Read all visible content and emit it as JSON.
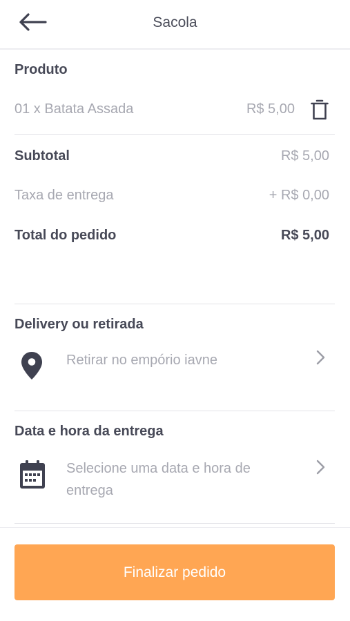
{
  "header": {
    "title": "Sacola",
    "back_icon": "arrow-left-icon"
  },
  "produto": {
    "heading": "Produto",
    "items": [
      {
        "text": "01 x Batata Assada",
        "price": "R$ 5,00",
        "icon": "trash-icon"
      }
    ]
  },
  "summary": {
    "subtotal_label": "Subtotal",
    "subtotal_value": "R$ 5,00",
    "fee_label": "Taxa de entrega",
    "fee_value": "+ R$ 0,00",
    "total_label": "Total do pedido",
    "total_value": "R$ 5,00"
  },
  "delivery": {
    "heading": "Delivery ou retirada",
    "value": "Retirar no empório iavne",
    "icon": "map-pin-icon"
  },
  "schedule": {
    "heading": "Data e hora da entrega",
    "value_line1": "Selecione uma data e hora de",
    "value_line2": "entrega",
    "icon": "calendar-icon"
  },
  "footer": {
    "button_label": "Finalizar pedido"
  },
  "colors": {
    "accent": "#ffa653",
    "text_dark": "#474957",
    "text_muted": "#a7a8b1",
    "divider": "#e2e2e7"
  }
}
